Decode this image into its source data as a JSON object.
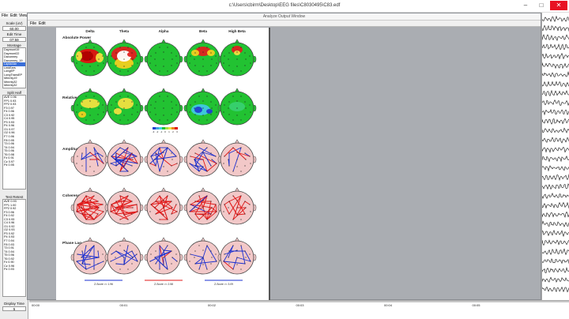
{
  "window": {
    "title": "c:\\Users\\cbirm\\Desktop\\EEG files\\C8030495\\C83.edf"
  },
  "menu": {
    "file": "File",
    "edit": "Edit",
    "view": "View"
  },
  "left_panel": {
    "scale_label": "Scale (uV)",
    "scale_value": "60.00",
    "edit_time_label": "Edit Time",
    "edit_time_value": "07:59",
    "montage_label": "Montage",
    "montage_items": [
      "Daymont19",
      "Daymont22",
      "Daxunney",
      "Daxunney_19",
      "Laplacian",
      "LinkEars",
      "LongEP",
      "LongTransEP",
      "Mmmly19",
      "Mmmly32",
      "Mmmly32"
    ],
    "split_half_label": "Split Half",
    "split_half_items": [
      "AVE 0.96",
      "FP1 0.93",
      "FP2 0.93",
      "F3 0.97",
      "F4 0.96",
      "C3 0.92",
      "C4 0.95",
      "P3 0.93",
      "P4 0.96",
      "O1 0.97",
      "O2 0.96",
      "F7 0.96",
      "F8 0.95",
      "T3 0.96",
      "T4 0.94",
      "T5 0.96",
      "T6 0.98",
      "Fz 0.91",
      "Cz 0.97",
      "Pz 0.95"
    ],
    "test_retest_label": "Test Retest",
    "test_retest_items": [
      "AVE 0.93",
      "FP1 1.00",
      "FP2 0.92",
      "F3 0.96",
      "F4 0.92",
      "C3 0.93",
      "C4 0.96",
      "O1 0.92",
      "O2 0.93",
      "P3 0.92",
      "P4 0.93",
      "F7 0.94",
      "F8 0.93",
      "T3 0.91",
      "T4 0.94",
      "T5 0.96",
      "T6 0.92",
      "Fz 0.90",
      "Cz 0.96",
      "Pz 0.93"
    ],
    "display_time_label": "Display Time",
    "display_time_value": "5"
  },
  "output_window": {
    "title": "Analyze Output Window",
    "menu_file": "File",
    "menu_edit": "Edit",
    "columns": [
      "Delta",
      "Theta",
      "Alpha",
      "Beta",
      "High Beta"
    ],
    "sections": [
      "Absolute Power",
      "Relative Power",
      "Amplitude Asymmetry",
      "Coherence",
      "Phase Lag"
    ],
    "scale_ticks": [
      "-3",
      "-2",
      "-1",
      "0",
      "1",
      "2",
      "3"
    ],
    "zscore_labels": [
      "Z-Score >= 1.96",
      "Z-Score >= 2.58",
      "Z-Score >= 3.09"
    ]
  },
  "timeline": {
    "ticks": [
      "00:00",
      "00:01",
      "00:02",
      "00:03",
      "00:04",
      "00:05"
    ]
  },
  "colors": {
    "panel": "#ececec",
    "workspace": "#aeb1b6",
    "red_line": "#e01818",
    "blue_line": "#1a2fd0",
    "green": "#22c232",
    "head_fill": "#f2c8c8"
  }
}
